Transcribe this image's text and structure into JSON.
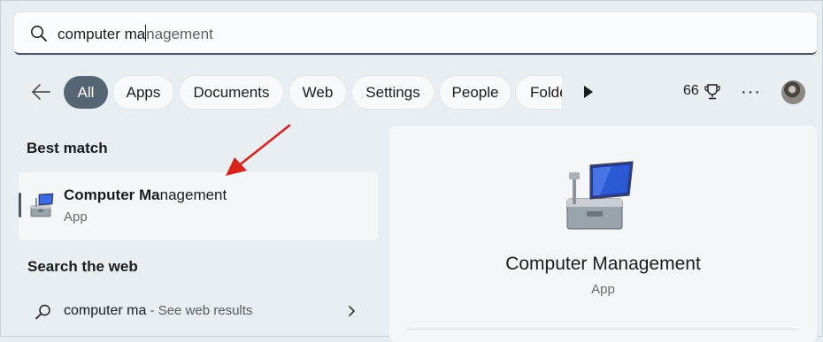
{
  "search": {
    "typed": "computer ma",
    "suggestion": "nagement"
  },
  "filters": [
    {
      "label": "All",
      "active": true
    },
    {
      "label": "Apps",
      "active": false
    },
    {
      "label": "Documents",
      "active": false
    },
    {
      "label": "Web",
      "active": false
    },
    {
      "label": "Settings",
      "active": false
    },
    {
      "label": "People",
      "active": false
    },
    {
      "label": "Folde",
      "active": false
    }
  ],
  "toolbar": {
    "points": "66",
    "more": "···"
  },
  "best_match": {
    "heading": "Best match",
    "name_bold": "Computer Ma",
    "name_rest": "nagement",
    "type": "App"
  },
  "web": {
    "heading": "Search the web",
    "query": "computer ma",
    "suffix": " - See web results"
  },
  "detail": {
    "title": "Computer Management",
    "type": "App"
  },
  "colors": {
    "accent": "#566573",
    "annotation_arrow": "#d9221c"
  }
}
